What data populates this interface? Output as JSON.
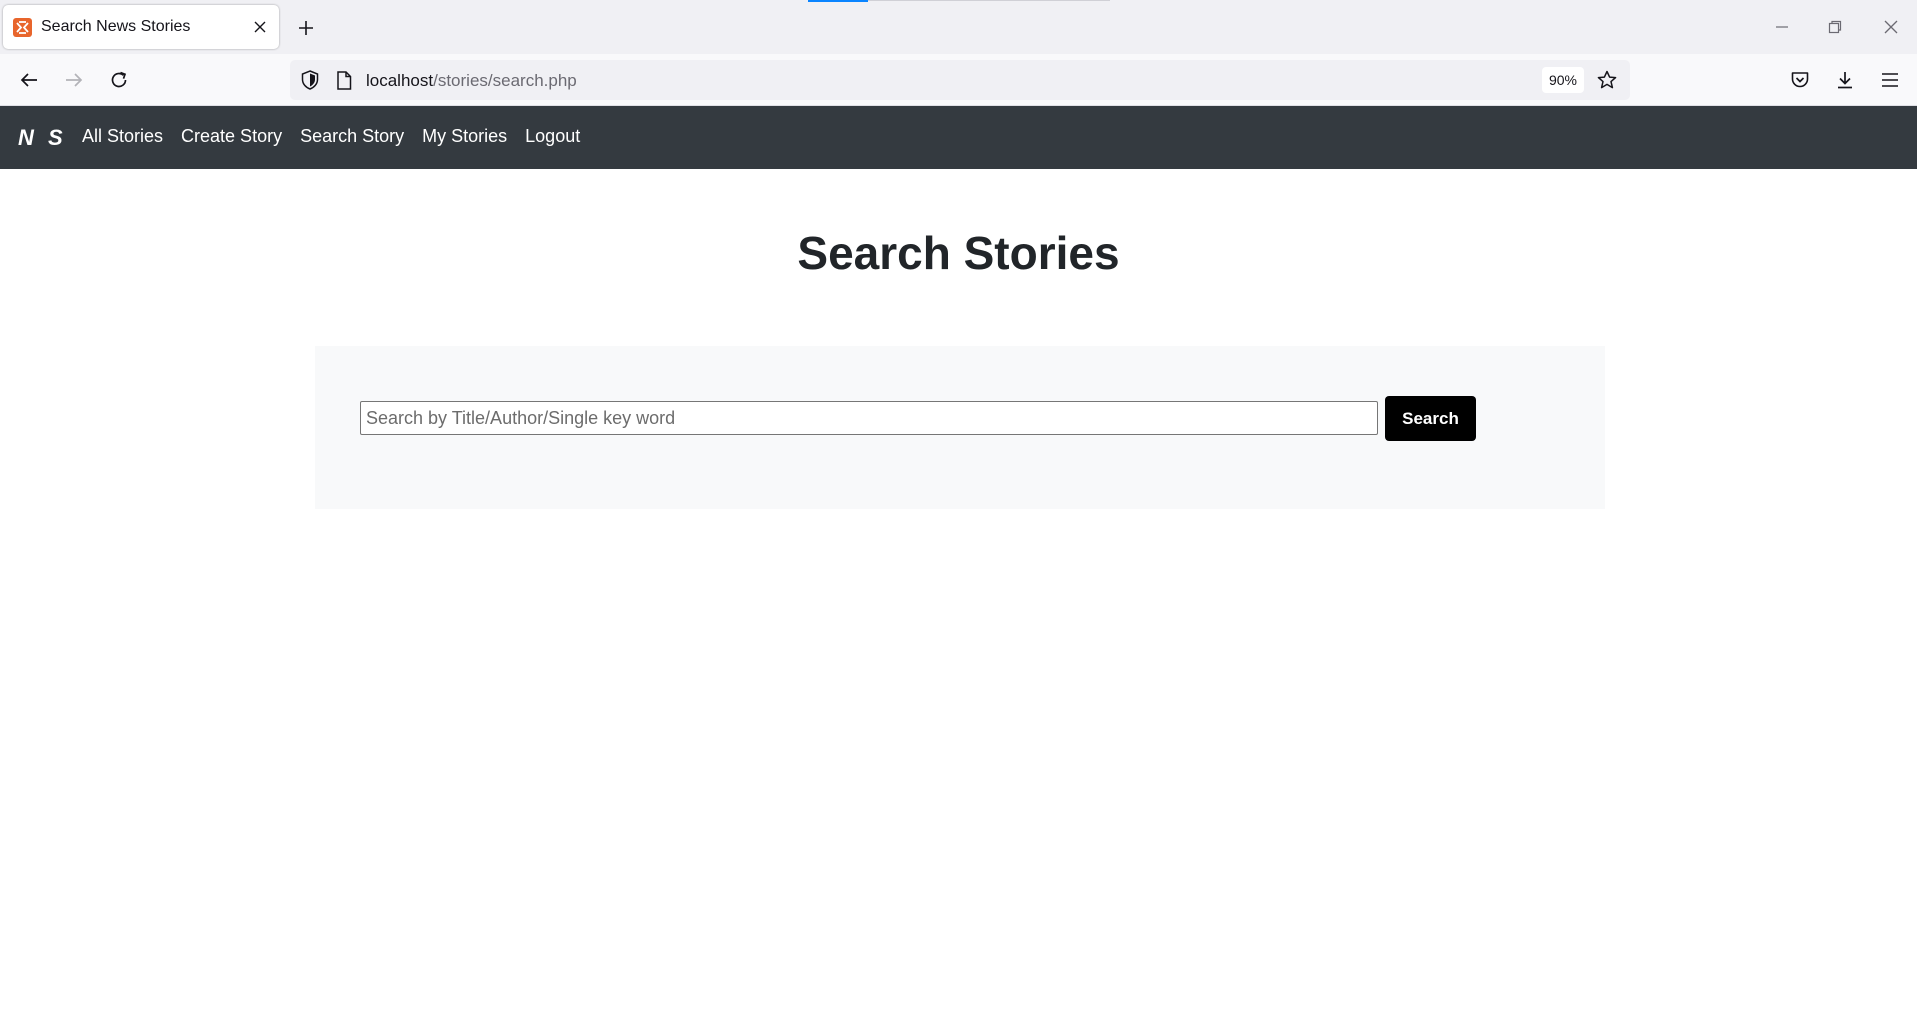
{
  "browser": {
    "tab_title": "Search News Stories",
    "url_host": "localhost",
    "url_path": "/stories/search.php",
    "zoom": "90%",
    "icons": {
      "favicon": "xampp-icon",
      "tab_close": "close-icon",
      "new_tab": "plus-icon",
      "back": "arrow-left-icon",
      "forward": "arrow-right-icon",
      "reload": "reload-icon",
      "shield": "shield-icon",
      "page": "page-icon",
      "bookmark": "star-icon",
      "pocket": "pocket-icon",
      "downloads": "download-icon",
      "menu": "hamburger-menu-icon",
      "minimize": "minimize-icon",
      "restore": "restore-icon",
      "close_window": "close-icon"
    }
  },
  "site_nav": {
    "brand": "N S",
    "links": [
      "All Stories",
      "Create Story",
      "Search Story",
      "My Stories",
      "Logout"
    ],
    "background": "#343a40"
  },
  "main": {
    "title": "Search Stories",
    "search": {
      "placeholder": "Search by Title/Author/Single key word",
      "value": "",
      "button_label": "Search"
    }
  }
}
